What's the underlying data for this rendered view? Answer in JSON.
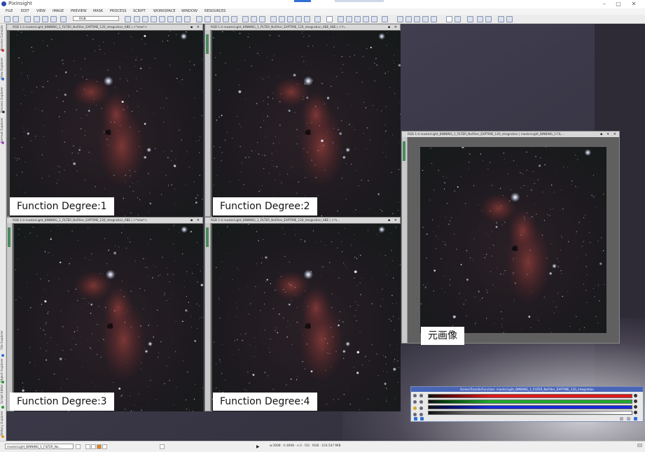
{
  "app": {
    "title": "PixInsight"
  },
  "menu": [
    "FILE",
    "EDIT",
    "VIEW",
    "IMAGE",
    "PREVIEW",
    "MASK",
    "PROCESS",
    "SCRIPT",
    "WORKSPACE",
    "WINDOW",
    "RESOURCES"
  ],
  "toolbar": {
    "channel_select": "RGB"
  },
  "sidebar": {
    "tabs": [
      "Process Console",
      "View Explorer",
      "Process Explorer",
      "Format Explorer",
      "File Explorer",
      "Object Explorer",
      "Script Editor",
      "History Explorer"
    ]
  },
  "windows": [
    {
      "title": "RGB 1:4 masterLight_BINNING_1_FILTER_NoFilter_EXPTIME_120_integration_ABE | <*new*>",
      "caption": "Function Degree:1"
    },
    {
      "title": "RGB 1:4 masterLight_BINNING_1_FILTER_NoFilter_EXPTIME_120_integration_ABE_ABE | <*n...",
      "caption": "Function Degree:2"
    },
    {
      "title": "RGB 1:4 masterLight_BINNING_1_FILTER_NoFilter_EXPTIME_120_integration_ABE | <*new*>",
      "caption": "Function Degree:3"
    },
    {
      "title": "RGB 1:4 masterLight_BINNING_1_FILTER_NoFilter_EXPTIME_120_integration_ABE | <*n...",
      "caption": "Function Degree:4"
    },
    {
      "title": "RGB 1:4 masterLight_BINNING_1_FILTER_NoFilter_EXPTIME_120_integration | masterLight_BINNING_1-FIL...",
      "caption": "元画像"
    }
  ],
  "stf": {
    "title": "ScreenTransferFunction: masterLight_BINNING_1_FILTER_NoFilter_EXPTIME_120_integration"
  },
  "statusbar": {
    "view_select": "masterLight_BINNING_1_FILTER_No...",
    "info": "w:3008 · h:3008 · n:3 · f32 · RGB · 103.547 MiB"
  },
  "colors": {
    "accent": "#4965b8",
    "red_bar": "#e0161a",
    "green_bar": "#1faa2d",
    "blue_bar": "#1a2bd8"
  }
}
